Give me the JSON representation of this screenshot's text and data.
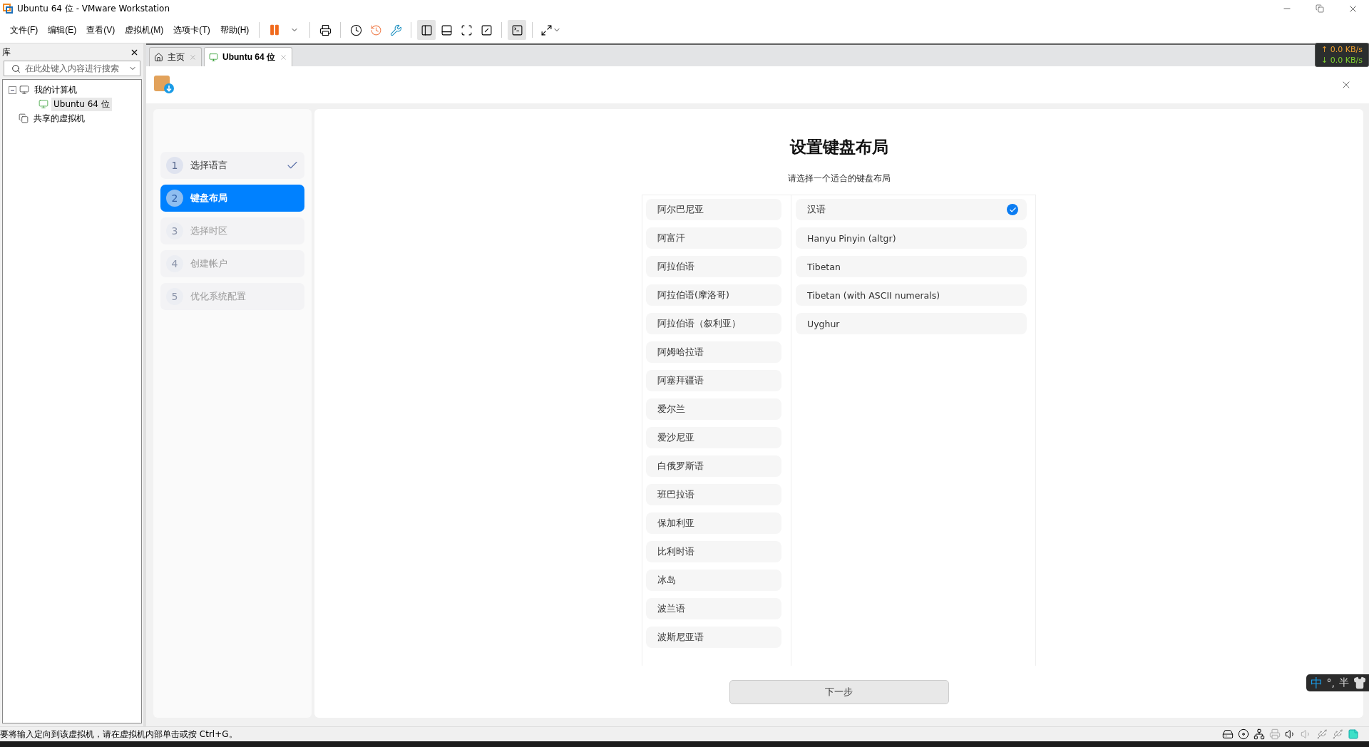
{
  "window": {
    "title": "Ubuntu 64 位 - VMware Workstation"
  },
  "menu": [
    "文件(F)",
    "编辑(E)",
    "查看(V)",
    "虚拟机(M)",
    "选项卡(T)",
    "帮助(H)"
  ],
  "library": {
    "title": "库",
    "search": {
      "placeholder": "在此处键入内容进行搜索"
    },
    "tree": [
      {
        "label": "我的计算机",
        "kind": "computer",
        "expanded": true,
        "selected": false,
        "children": [
          {
            "label": "Ubuntu 64 位",
            "kind": "vm",
            "selected": true
          }
        ]
      },
      {
        "label": "共享的虚拟机",
        "kind": "shared",
        "selected": false
      }
    ]
  },
  "tabs": [
    {
      "label": "主页",
      "kind": "home",
      "selected": false
    },
    {
      "label": "Ubuntu 64 位",
      "kind": "vm",
      "selected": true
    }
  ],
  "net_speed": {
    "upload": "↑ 0.0 KB/s",
    "download": "↓ 0.0 KB/s"
  },
  "installer": {
    "steps": [
      {
        "number": "1",
        "label": "选择语言",
        "completed": true,
        "selected": false
      },
      {
        "number": "2",
        "label": "键盘布局",
        "completed": false,
        "selected": true
      },
      {
        "number": "3",
        "label": "选择时区",
        "completed": false,
        "selected": false
      },
      {
        "number": "4",
        "label": "创建帐户",
        "completed": false,
        "selected": false
      },
      {
        "number": "5",
        "label": "优化系统配置",
        "completed": false,
        "selected": false
      }
    ],
    "title": "设置键盘布局",
    "subtitle": "请选择一个适合的键盘布局",
    "layouts": [
      {
        "label": "阿尔巴尼亚",
        "selected": false
      },
      {
        "label": "阿富汗",
        "selected": false
      },
      {
        "label": "阿拉伯语",
        "selected": false
      },
      {
        "label": "阿拉伯语(摩洛哥)",
        "selected": false
      },
      {
        "label": "阿拉伯语（叙利亚）",
        "selected": false
      },
      {
        "label": "阿姆哈拉语",
        "selected": false
      },
      {
        "label": "阿塞拜疆语",
        "selected": false
      },
      {
        "label": "爱尔兰",
        "selected": false
      },
      {
        "label": "爱沙尼亚",
        "selected": false
      },
      {
        "label": "白俄罗斯语",
        "selected": false
      },
      {
        "label": "班巴拉语",
        "selected": false
      },
      {
        "label": "保加利亚",
        "selected": false
      },
      {
        "label": "比利时语",
        "selected": false
      },
      {
        "label": "冰岛",
        "selected": false
      },
      {
        "label": "波兰语",
        "selected": false
      },
      {
        "label": "波斯尼亚语",
        "selected": false
      }
    ],
    "variants": [
      {
        "label": "汉语",
        "selected": true
      },
      {
        "label": "Hanyu Pinyin (altgr)",
        "selected": false
      },
      {
        "label": "Tibetan",
        "selected": false
      },
      {
        "label": "Tibetan (with ASCII numerals)",
        "selected": false
      },
      {
        "label": "Uyghur",
        "selected": false
      }
    ],
    "next_button": "下一步"
  },
  "ime": {
    "mode": "中",
    "punctuation": "°,",
    "width": "半"
  },
  "status_bar": "要将输入定向到该虚拟机，请在虚拟机内部单击或按 Ctrl+G。"
}
